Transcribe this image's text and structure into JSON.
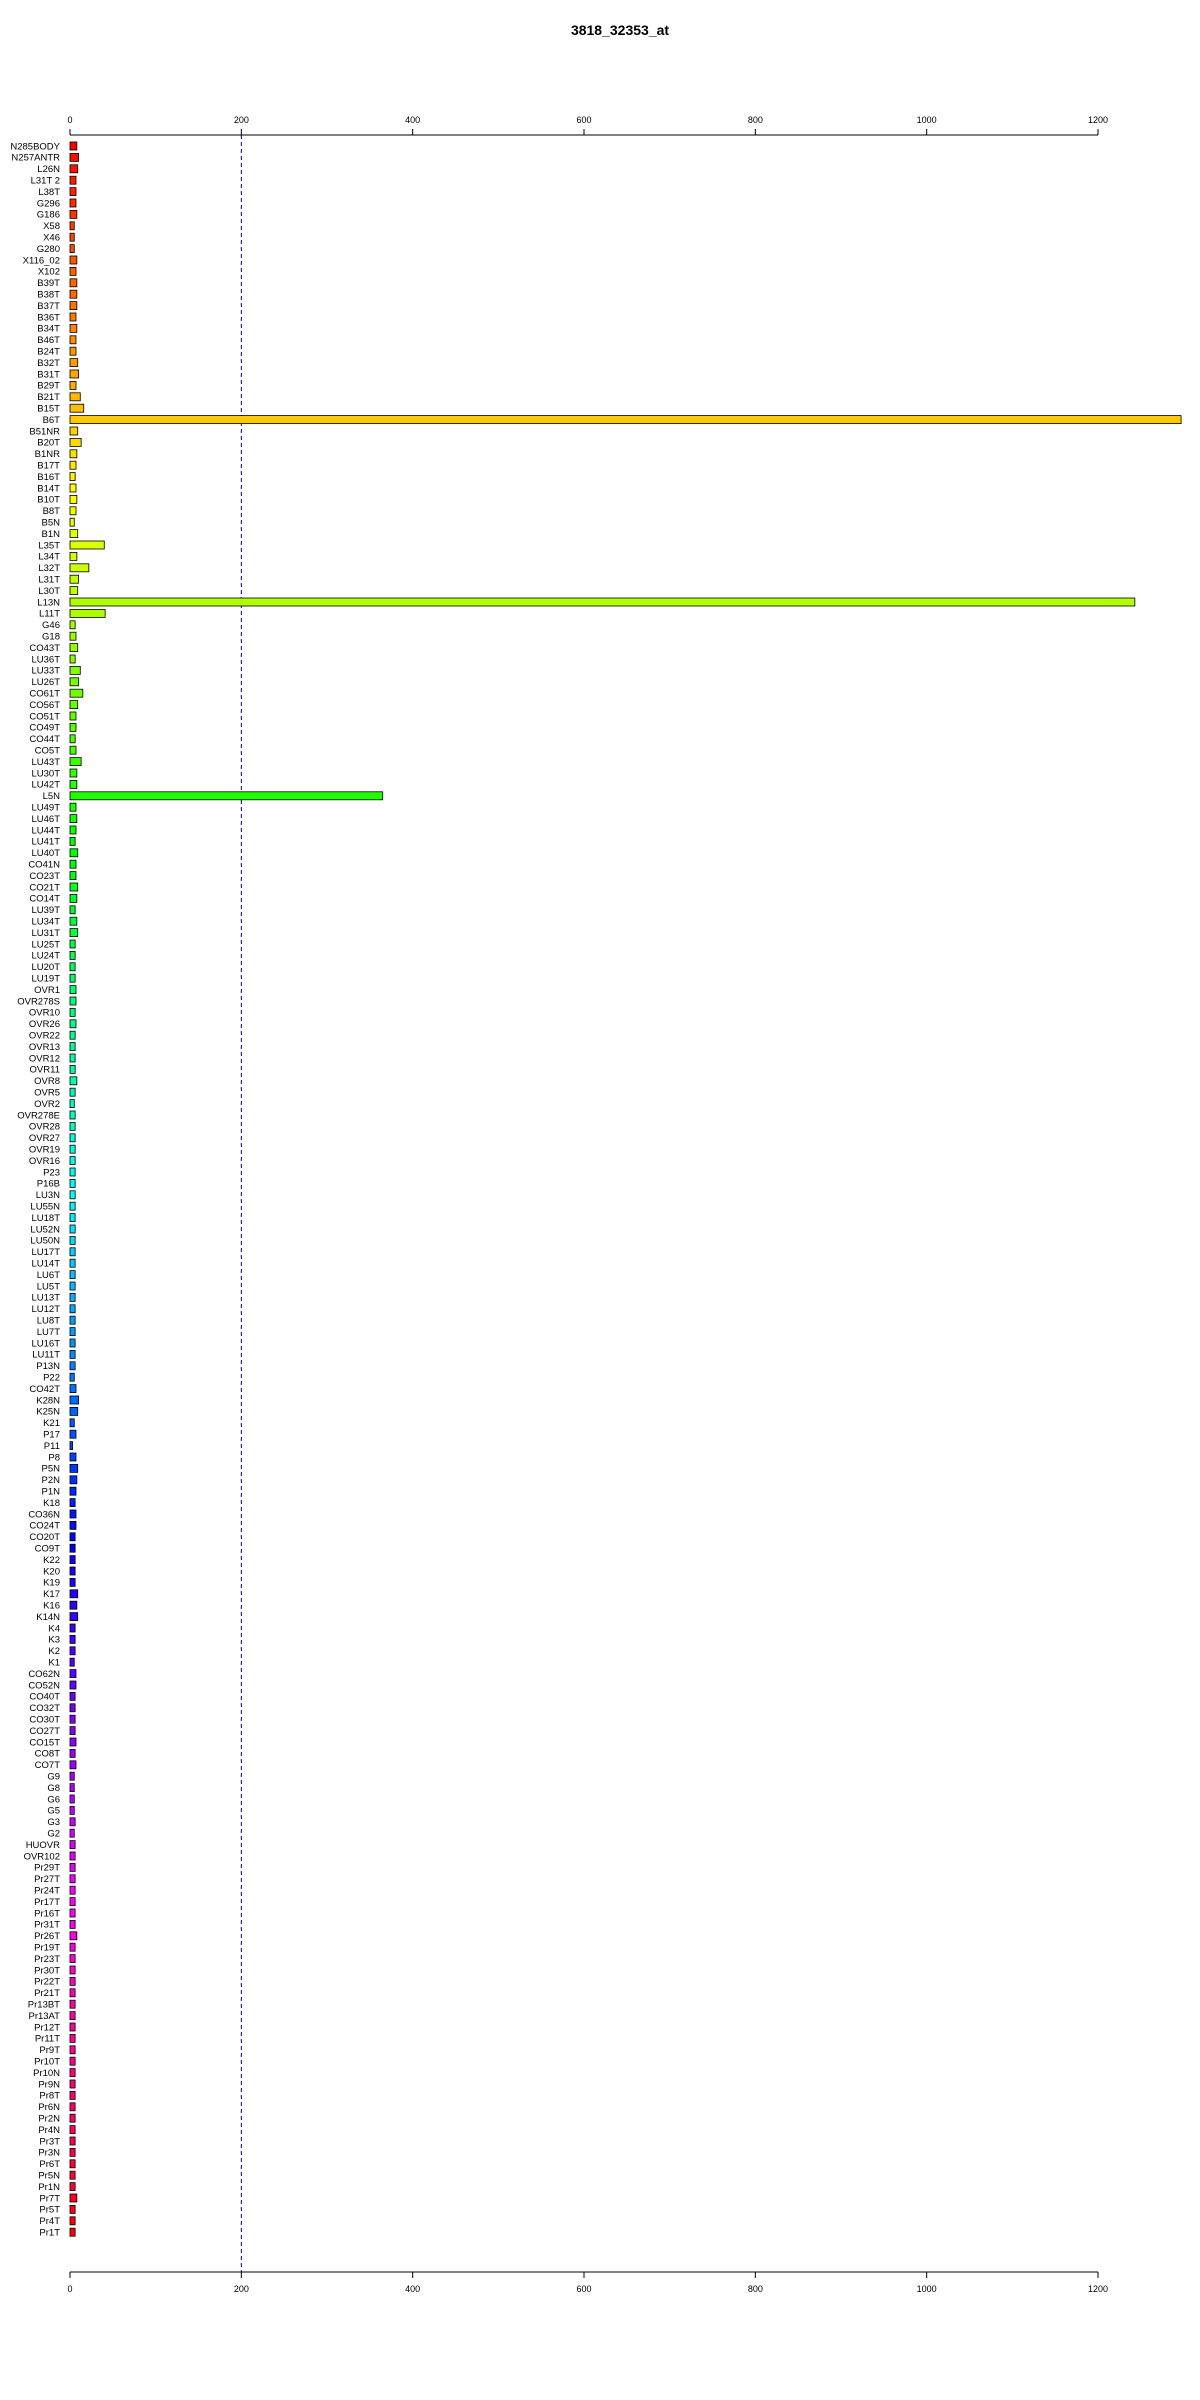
{
  "chart_data": {
    "type": "bar",
    "orientation": "horizontal",
    "title": "3818_32353_at",
    "xlabel": "",
    "ylabel": "",
    "xlim": [
      0,
      1200
    ],
    "x_ticks": [
      0,
      200,
      400,
      600,
      800,
      1000,
      1200
    ],
    "reference_line": 200,
    "grid": false,
    "categories": [
      "N285BODY",
      "N257ANTR",
      "L26N",
      "L31T 2",
      "L38T",
      "G296",
      "G186",
      "X58",
      "X46",
      "G280",
      "X116_02",
      "X102",
      "B39T",
      "B38T",
      "B37T",
      "B36T",
      "B34T",
      "B46T",
      "B24T",
      "B32T",
      "B31T",
      "B29T",
      "B21T",
      "B15T",
      "B6T",
      "B51NR",
      "B20T",
      "B1NR",
      "B17T",
      "B16T",
      "B14T",
      "B10T",
      "B8T",
      "B5N",
      "B1N",
      "L35T",
      "L34T",
      "L32T",
      "L31T",
      "L30T",
      "L13N",
      "L11T",
      "G46",
      "G18",
      "CO43T",
      "LU36T",
      "LU33T",
      "LU26T",
      "CO61T",
      "CO56T",
      "CO51T",
      "CO49T",
      "CO44T",
      "CO5T",
      "LU43T",
      "LU30T",
      "LU42T",
      "L5N",
      "LU49T",
      "LU46T",
      "LU44T",
      "LU41T",
      "LU40T",
      "CO41N",
      "CO23T",
      "CO21T",
      "CO14T",
      "LU39T",
      "LU34T",
      "LU31T",
      "LU25T",
      "LU24T",
      "LU20T",
      "LU19T",
      "OVR1",
      "OVR278S",
      "OVR10",
      "OVR26",
      "OVR22",
      "OVR13",
      "OVR12",
      "OVR11",
      "OVR8",
      "OVR5",
      "OVR2",
      "OVR278E",
      "OVR28",
      "OVR27",
      "OVR19",
      "OVR16",
      "P23",
      "P16B",
      "LU3N",
      "LU55N",
      "LU18T",
      "LU52N",
      "LU50N",
      "LU17T",
      "LU14T",
      "LU6T",
      "LU5T",
      "LU13T",
      "LU12T",
      "LU8T",
      "LU7T",
      "LU16T",
      "LU11T",
      "P13N",
      "P22",
      "CO42T",
      "K28N",
      "K25N",
      "K21",
      "P17",
      "P11",
      "P8",
      "P5N",
      "P2N",
      "P1N",
      "K18",
      "CO36N",
      "CO24T",
      "CO20T",
      "CO9T",
      "K22",
      "K20",
      "K19",
      "K17",
      "K16",
      "K14N",
      "K4",
      "K3",
      "K2",
      "K1",
      "CO62N",
      "CO52N",
      "CO40T",
      "CO32T",
      "CO30T",
      "CO27T",
      "CO15T",
      "CO8T",
      "CO7T",
      "G9",
      "G8",
      "G6",
      "G5",
      "G3",
      "G2",
      "HUOVR",
      "OVR102",
      "Pr29T",
      "Pr27T",
      "Pr24T",
      "Pr17T",
      "Pr16T",
      "Pr31T",
      "Pr26T",
      "Pr19T",
      "Pr23T",
      "Pr30T",
      "Pr22T",
      "Pr21T",
      "Pr13BT",
      "Pr13AT",
      "Pr12T",
      "Pr11T",
      "Pr9T",
      "Pr10T",
      "Pr10N",
      "Pr9N",
      "Pr8T",
      "Pr6N",
      "Pr2N",
      "Pr4N",
      "Pr3T",
      "Pr3N",
      "Pr6T",
      "Pr5N",
      "Pr1N",
      "Pr7T",
      "Pr5T",
      "Pr4T",
      "Pr1T"
    ],
    "values": [
      8,
      10,
      9,
      7,
      7,
      7,
      8,
      5,
      5,
      5,
      8,
      7,
      8,
      8,
      8,
      7,
      8,
      7,
      7,
      9,
      10,
      7,
      12,
      16,
      1297,
      9,
      13,
      8,
      7,
      6,
      7,
      8,
      7,
      5,
      9,
      40,
      8,
      22,
      10,
      9,
      1243,
      41,
      6,
      7,
      9,
      6,
      12,
      10,
      15,
      9,
      7,
      7,
      6,
      7,
      13,
      8,
      8,
      365,
      7,
      8,
      7,
      6,
      9,
      7,
      7,
      9,
      8,
      6,
      8,
      9,
      6,
      6,
      6,
      6,
      7,
      7,
      6,
      7,
      6,
      6,
      6,
      6,
      8,
      6,
      5,
      6,
      6,
      6,
      6,
      6,
      6,
      6,
      6,
      6,
      6,
      6,
      6,
      6,
      6,
      6,
      6,
      6,
      6,
      6,
      6,
      6,
      6,
      6,
      5,
      7,
      10,
      9,
      5,
      7,
      3,
      7,
      9,
      8,
      7,
      6,
      7,
      7,
      6,
      6,
      6,
      6,
      6,
      9,
      8,
      9,
      6,
      6,
      6,
      5,
      7,
      7,
      6,
      6,
      6,
      6,
      7,
      6,
      7,
      5,
      5,
      5,
      5,
      6,
      5,
      6,
      6,
      6,
      6,
      6,
      6,
      6,
      6,
      8,
      6,
      6,
      6,
      6,
      6,
      6,
      6,
      6,
      6,
      6,
      6,
      6,
      6,
      6,
      6,
      6,
      6,
      6,
      6,
      6,
      6,
      6,
      8,
      6,
      6,
      6,
      6,
      6,
      6
    ]
  }
}
